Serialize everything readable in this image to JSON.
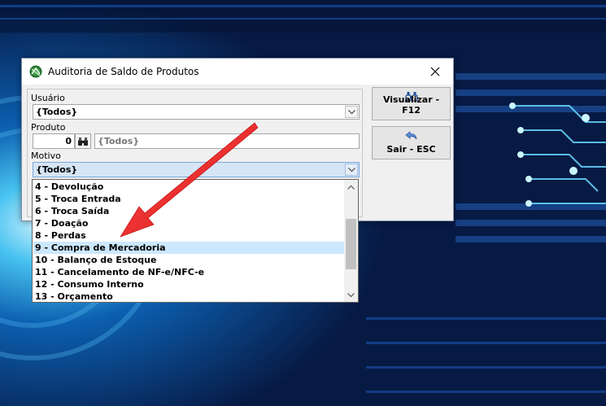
{
  "window": {
    "title": "Auditoria de Saldo de Produtos"
  },
  "form": {
    "usuario_label": "Usuário",
    "usuario_value": "{Todos}",
    "produto_label": "Produto",
    "produto_code": "0",
    "produto_name": "{Todos}",
    "motivo_label": "Motivo",
    "motivo_value": "{Todos}"
  },
  "buttons": {
    "visualizar": "Visualizar - F12",
    "sair": "Sair - ESC"
  },
  "dropdown": {
    "items": [
      "4 - Devolução",
      "5 - Troca Entrada",
      "6 - Troca Saída",
      "7 - Doação",
      "8 - Perdas",
      "9 - Compra de Mercadoria",
      "10 - Balanço de Estoque",
      "11 - Cancelamento de NF-e/NFC-e",
      "12 - Consumo Interno",
      "13 - Orçamento"
    ],
    "selected": "9 - Compra de Mercadoria"
  },
  "icons": {
    "app": "app-logo-icon",
    "close": "close-icon",
    "search": "binoculars-icon",
    "exit": "back-arrow-icon",
    "dropdown": "chevron-down-icon"
  },
  "colors": {
    "selection": "#cce8ff",
    "annotation_arrow": "#e8202a",
    "background": "#0a1f4a"
  }
}
